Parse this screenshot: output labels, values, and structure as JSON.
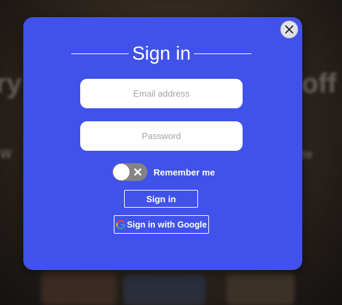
{
  "background": {
    "left_heading": "ry",
    "right_heading": "off",
    "left_subtext": "W",
    "right_subtext": "te"
  },
  "modal": {
    "title": "Sign in",
    "email": {
      "placeholder": "Email address",
      "value": ""
    },
    "password": {
      "placeholder": "Password",
      "value": ""
    },
    "remember": {
      "label": "Remember me",
      "checked": false
    },
    "signin_label": "Sign in",
    "google_label": "Sign in with Google"
  },
  "colors": {
    "modal_bg": "#4052ea",
    "toggle_off": "#838383",
    "text": "#ffffff"
  },
  "icons": {
    "close": "close-icon",
    "toggle": "x-icon",
    "google": "google-icon"
  }
}
